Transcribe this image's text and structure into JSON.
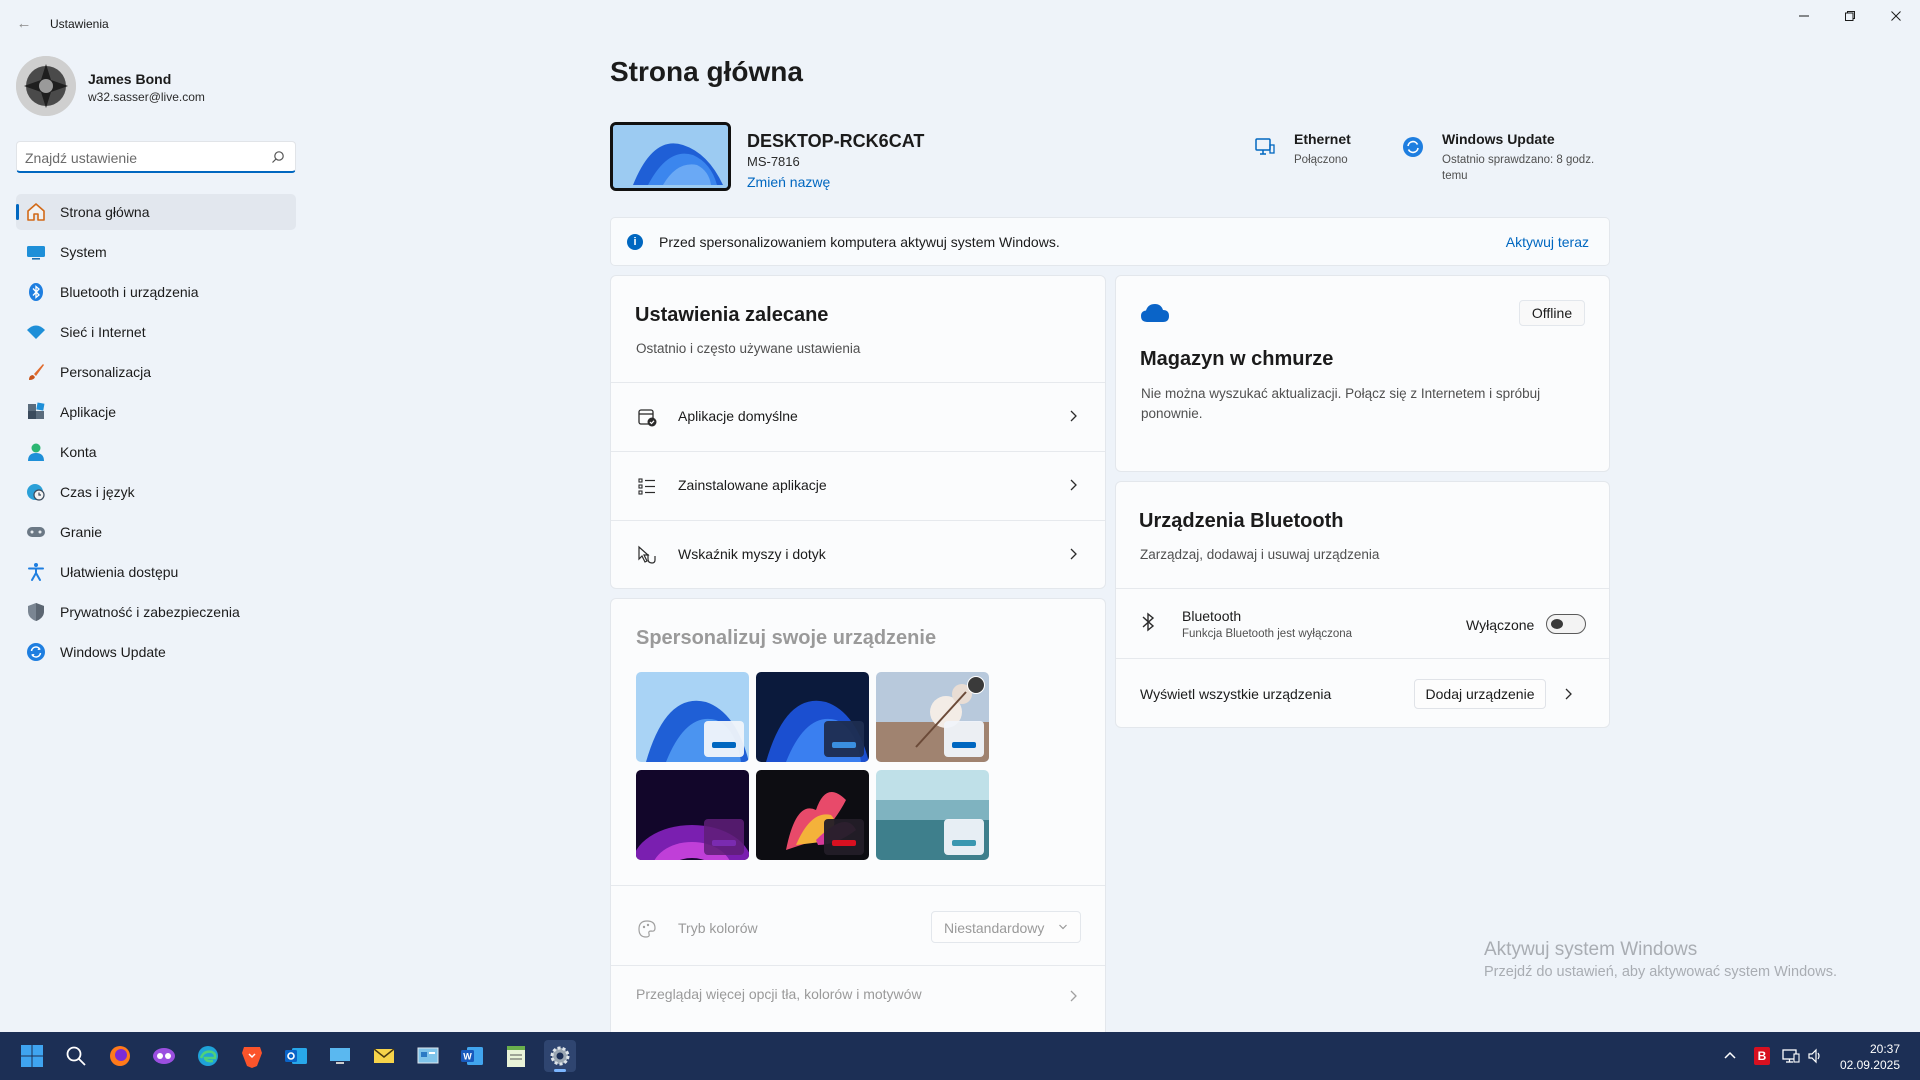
{
  "window": {
    "title": "Ustawienia"
  },
  "profile": {
    "name": "James Bond",
    "email": "w32.sasser@live.com"
  },
  "search": {
    "placeholder": "Znajdź ustawienie"
  },
  "nav": {
    "items": [
      {
        "label": "Strona główna",
        "icon": "home-icon"
      },
      {
        "label": "System",
        "icon": "monitor-icon"
      },
      {
        "label": "Bluetooth i urządzenia",
        "icon": "bluetooth-icon"
      },
      {
        "label": "Sieć i Internet",
        "icon": "wifi-icon"
      },
      {
        "label": "Personalizacja",
        "icon": "brush-icon"
      },
      {
        "label": "Aplikacje",
        "icon": "apps-icon"
      },
      {
        "label": "Konta",
        "icon": "person-icon"
      },
      {
        "label": "Czas i język",
        "icon": "globe-clock-icon"
      },
      {
        "label": "Granie",
        "icon": "gamepad-icon"
      },
      {
        "label": "Ułatwienia dostępu",
        "icon": "accessibility-icon"
      },
      {
        "label": "Prywatność i zabezpieczenia",
        "icon": "shield-icon"
      },
      {
        "label": "Windows Update",
        "icon": "update-icon"
      }
    ]
  },
  "main": {
    "title": "Strona główna",
    "device": {
      "name": "DESKTOP-RCK6CAT",
      "model": "MS-7816",
      "rename": "Zmień nazwę"
    },
    "ethernet": {
      "title": "Ethernet",
      "status": "Połączono"
    },
    "update": {
      "title": "Windows Update",
      "status": "Ostatnio sprawdzano: 8 godz. temu"
    },
    "banner": {
      "text": "Przed spersonalizowaniem komputera aktywuj system Windows.",
      "action": "Aktywuj teraz"
    },
    "recommended": {
      "title": "Ustawienia zalecane",
      "subtitle": "Ostatnio i często używane ustawienia",
      "items": [
        {
          "label": "Aplikacje domyślne",
          "icon": "default-apps-icon"
        },
        {
          "label": "Zainstalowane aplikacje",
          "icon": "list-icon"
        },
        {
          "label": "Wskaźnik myszy i dotyk",
          "icon": "pointer-icon"
        }
      ]
    },
    "personalize": {
      "title": "Spersonalizuj swoje urządzenie",
      "color_mode_label": "Tryb kolorów",
      "color_mode_value": "Niestandardowy",
      "more_label": "Przeglądaj więcej opcji tła, kolorów i motywów"
    },
    "cloud": {
      "badge": "Offline",
      "title": "Magazyn w chmurze",
      "message": "Nie można wyszukać aktualizacji. Połącz się z Internetem i spróbuj ponownie."
    },
    "bluetooth": {
      "title": "Urządzenia Bluetooth",
      "subtitle": "Zarządzaj, dodawaj i usuwaj urządzenia",
      "device_label": "Bluetooth",
      "device_status": "Funkcja Bluetooth jest wyłączona",
      "toggle_label": "Wyłączone",
      "toggle_on": false,
      "view_all": "Wyświetl wszystkie urządzenia",
      "add_button": "Dodaj urządzenie"
    }
  },
  "watermark": {
    "line1": "Aktywuj system Windows",
    "line2": "Przejdź do ustawień, aby aktywować system Windows."
  },
  "taskbar": {
    "time": "20:37",
    "date": "02.09.2025"
  },
  "colors": {
    "accent": "#0067c0",
    "taskbar": "#1c2f55",
    "background": "#eef3f9"
  }
}
